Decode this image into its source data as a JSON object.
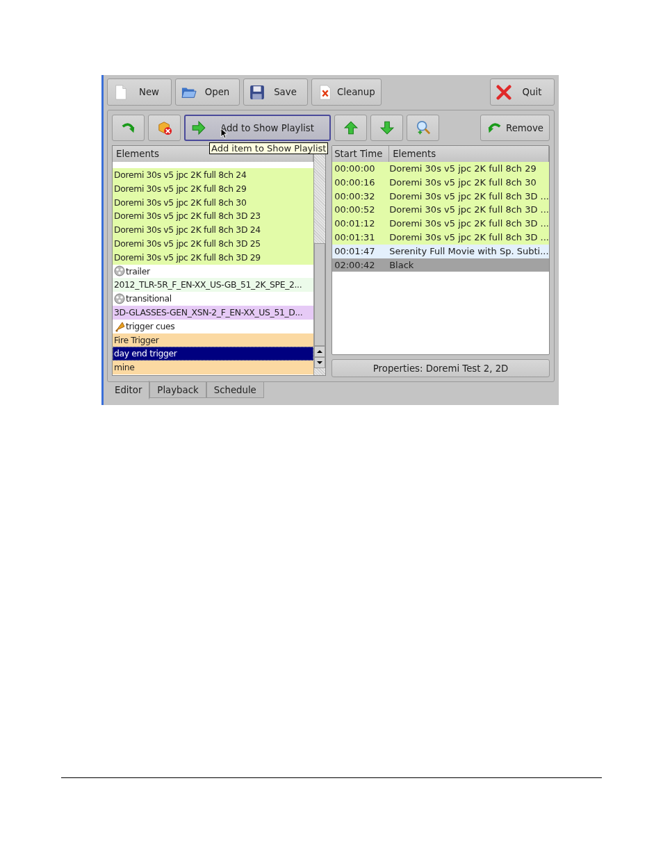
{
  "toolbar": [
    {
      "label": "New"
    },
    {
      "label": "Open"
    },
    {
      "label": "Save"
    },
    {
      "label": "Cleanup"
    }
  ],
  "quit_button": {
    "label": "Quit"
  },
  "add_button": {
    "label": "Add to Show Playlist",
    "selected": true
  },
  "remove_button": {
    "label": "Remove"
  },
  "tooltip": "Add item to Show Playlist",
  "elements_list": {
    "header": "Elements",
    "rows": [
      {
        "kind": "item",
        "label": "Doremi 30s v5 jpc 2K full 8ch 24",
        "color": "#e2fba8",
        "selected": false
      },
      {
        "kind": "item",
        "label": "Doremi 30s v5 jpc 2K full 8ch 29",
        "color": "#e2fba8",
        "selected": false
      },
      {
        "kind": "item",
        "label": "Doremi 30s v5 jpc 2K full 8ch 30",
        "color": "#e2fba8",
        "selected": false
      },
      {
        "kind": "item",
        "label": "Doremi 30s v5 jpc 2K full 8ch 3D 23",
        "color": "#e2fba8",
        "selected": false
      },
      {
        "kind": "item",
        "label": "Doremi 30s v5 jpc 2K full 8ch 3D 24",
        "color": "#e2fba8",
        "selected": false
      },
      {
        "kind": "item",
        "label": "Doremi 30s v5 jpc 2K full 8ch 3D 25",
        "color": "#e2fba8",
        "selected": false
      },
      {
        "kind": "item",
        "label": "Doremi 30s v5 jpc 2K full 8ch 3D 29",
        "color": "#e2fba8",
        "selected": false
      },
      {
        "kind": "group",
        "label": "trailer"
      },
      {
        "kind": "item",
        "label": "2012_TLR-5R_F_EN-XX_US-GB_51_2K_SPE_2...",
        "color": "#ecfbea",
        "selected": false
      },
      {
        "kind": "group",
        "label": "transitional"
      },
      {
        "kind": "item",
        "label": "3D-GLASSES-GEN_XSN-2_F_EN-XX_US_51_D...",
        "color": "#e6caf6",
        "selected": false
      },
      {
        "kind": "cues",
        "label": "trigger cues"
      },
      {
        "kind": "item",
        "label": "Fire Trigger",
        "color": "#fbd9a2",
        "selected": false
      },
      {
        "kind": "item",
        "label": "day end trigger",
        "selected": true
      },
      {
        "kind": "item",
        "label": "mine",
        "color": "#fbd9a2",
        "selected": false
      }
    ]
  },
  "playlist": {
    "columns": [
      "Start Time",
      "Elements"
    ],
    "rows": [
      {
        "start_time": "00:00:00",
        "element": "Doremi 30s v5 jpc 2K full 8ch 29",
        "color": "#e2fba8",
        "selected": false
      },
      {
        "start_time": "00:00:16",
        "element": "Doremi 30s v5 jpc 2K full 8ch 30",
        "color": "#e2fba8",
        "selected": false
      },
      {
        "start_time": "00:00:32",
        "element": "Doremi 30s v5 jpc 2K full 8ch 3D ...",
        "color": "#e2fba8",
        "selected": false
      },
      {
        "start_time": "00:00:52",
        "element": "Doremi 30s v5 jpc 2K full 8ch 3D ...",
        "color": "#e2fba8",
        "selected": false
      },
      {
        "start_time": "00:01:12",
        "element": "Doremi 30s v5 jpc 2K full 8ch 3D ...",
        "color": "#e2fba8",
        "selected": false
      },
      {
        "start_time": "00:01:31",
        "element": "Doremi 30s v5 jpc 2K full 8ch 3D ...",
        "color": "#e2fba8",
        "selected": false
      },
      {
        "start_time": "00:01:47",
        "element": "Serenity Full Movie with Sp. Subti...",
        "color": "#e4f0fc",
        "selected": false
      },
      {
        "start_time": "02:00:42",
        "element": "Black",
        "selected": true
      }
    ]
  },
  "properties_button": {
    "label": "Properties: Doremi Test 2, 2D"
  },
  "tabs": [
    {
      "label": "Editor",
      "selected": true
    },
    {
      "label": "Playback",
      "selected": false
    },
    {
      "label": "Schedule",
      "selected": false
    }
  ]
}
